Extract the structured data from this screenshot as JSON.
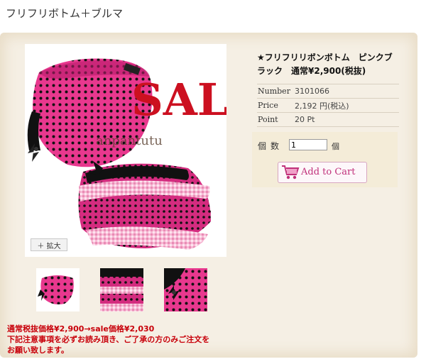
{
  "page": {
    "title": "フリフリボトム＋ブルマ"
  },
  "photo": {
    "sale_text": "SALE",
    "watermark": "anpantutu",
    "zoom_label": "＋ 拡大"
  },
  "product": {
    "name": "★フリフリリボンボトム　ピンクブラック　通常¥2,900(税抜)",
    "specs": [
      {
        "label": "Number",
        "value": "3101066"
      },
      {
        "label": "Price",
        "value": "2,192 円(税込)"
      },
      {
        "label": "Point",
        "value": "20 Pt"
      }
    ]
  },
  "cart": {
    "qty_label": "個数",
    "qty_value": "1",
    "qty_unit": "個",
    "add_label": "Add to Cart"
  },
  "notice": {
    "line1": "通常税抜価格¥2,900→sale価格¥2,030",
    "line2": "下記注意事項を必ずお読み頂き、ご了承の方のみご注文を",
    "line3": "お願い致します。"
  },
  "colors": {
    "pink": "#e8388e",
    "dark_pink": "#c9206f",
    "sale_red": "#cc1020",
    "notice_red": "#c8000a",
    "frame": "#f5efe4"
  },
  "icons": [
    "plus-icon",
    "shopping-cart-icon"
  ]
}
